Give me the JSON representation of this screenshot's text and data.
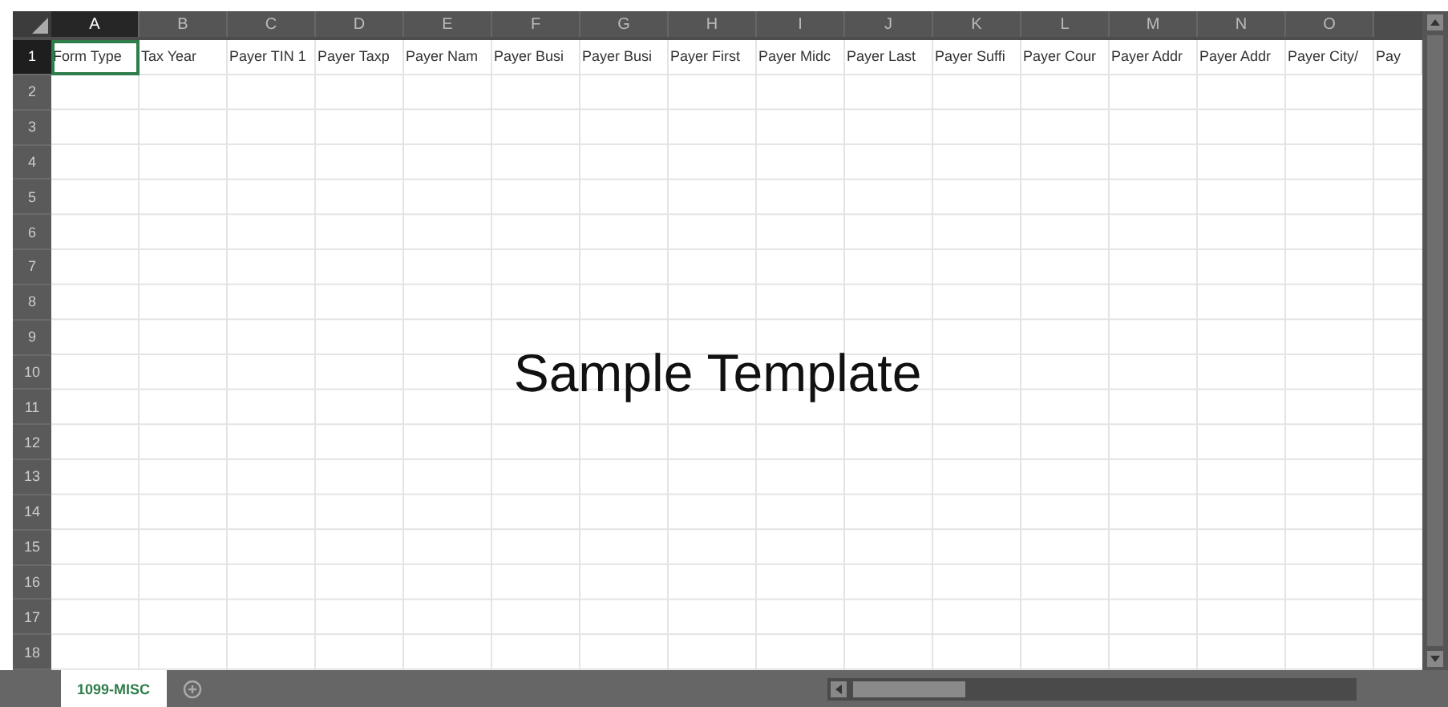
{
  "columns": [
    {
      "label": "A",
      "selected": true
    },
    {
      "label": "B",
      "selected": false
    },
    {
      "label": "C",
      "selected": false
    },
    {
      "label": "D",
      "selected": false
    },
    {
      "label": "E",
      "selected": false
    },
    {
      "label": "F",
      "selected": false
    },
    {
      "label": "G",
      "selected": false
    },
    {
      "label": "H",
      "selected": false
    },
    {
      "label": "I",
      "selected": false
    },
    {
      "label": "J",
      "selected": false
    },
    {
      "label": "K",
      "selected": false
    },
    {
      "label": "L",
      "selected": false
    },
    {
      "label": "M",
      "selected": false
    },
    {
      "label": "N",
      "selected": false
    },
    {
      "label": "O",
      "selected": false
    }
  ],
  "rows": [
    {
      "label": "1",
      "selected": true
    },
    {
      "label": "2",
      "selected": false
    },
    {
      "label": "3",
      "selected": false
    },
    {
      "label": "4",
      "selected": false
    },
    {
      "label": "5",
      "selected": false
    },
    {
      "label": "6",
      "selected": false
    },
    {
      "label": "7",
      "selected": false
    },
    {
      "label": "8",
      "selected": false
    },
    {
      "label": "9",
      "selected": false
    },
    {
      "label": "10",
      "selected": false
    },
    {
      "label": "11",
      "selected": false
    },
    {
      "label": "12",
      "selected": false
    },
    {
      "label": "13",
      "selected": false
    },
    {
      "label": "14",
      "selected": false
    },
    {
      "label": "15",
      "selected": false
    },
    {
      "label": "16",
      "selected": false
    },
    {
      "label": "17",
      "selected": false
    },
    {
      "label": "18",
      "selected": false
    }
  ],
  "header_cells": [
    {
      "text": "Form Type",
      "selected": true
    },
    {
      "text": "Tax Year",
      "selected": false
    },
    {
      "text": "Payer TIN 1",
      "selected": false
    },
    {
      "text": "Payer Taxp",
      "selected": false
    },
    {
      "text": "Payer Nam",
      "selected": false
    },
    {
      "text": "Payer Busi",
      "selected": false
    },
    {
      "text": "Payer Busi",
      "selected": false
    },
    {
      "text": "Payer First",
      "selected": false
    },
    {
      "text": "Payer Midc",
      "selected": false
    },
    {
      "text": "Payer Last",
      "selected": false
    },
    {
      "text": "Payer Suffi",
      "selected": false
    },
    {
      "text": "Payer Cour",
      "selected": false
    },
    {
      "text": "Payer Addr",
      "selected": false
    },
    {
      "text": "Payer Addr",
      "selected": false
    },
    {
      "text": "Payer City/",
      "selected": false
    },
    {
      "text": "Pay",
      "selected": false
    }
  ],
  "overlay_text": "Sample Template",
  "sheet_tabs": [
    {
      "label": "1099-MISC",
      "selected": true
    }
  ]
}
